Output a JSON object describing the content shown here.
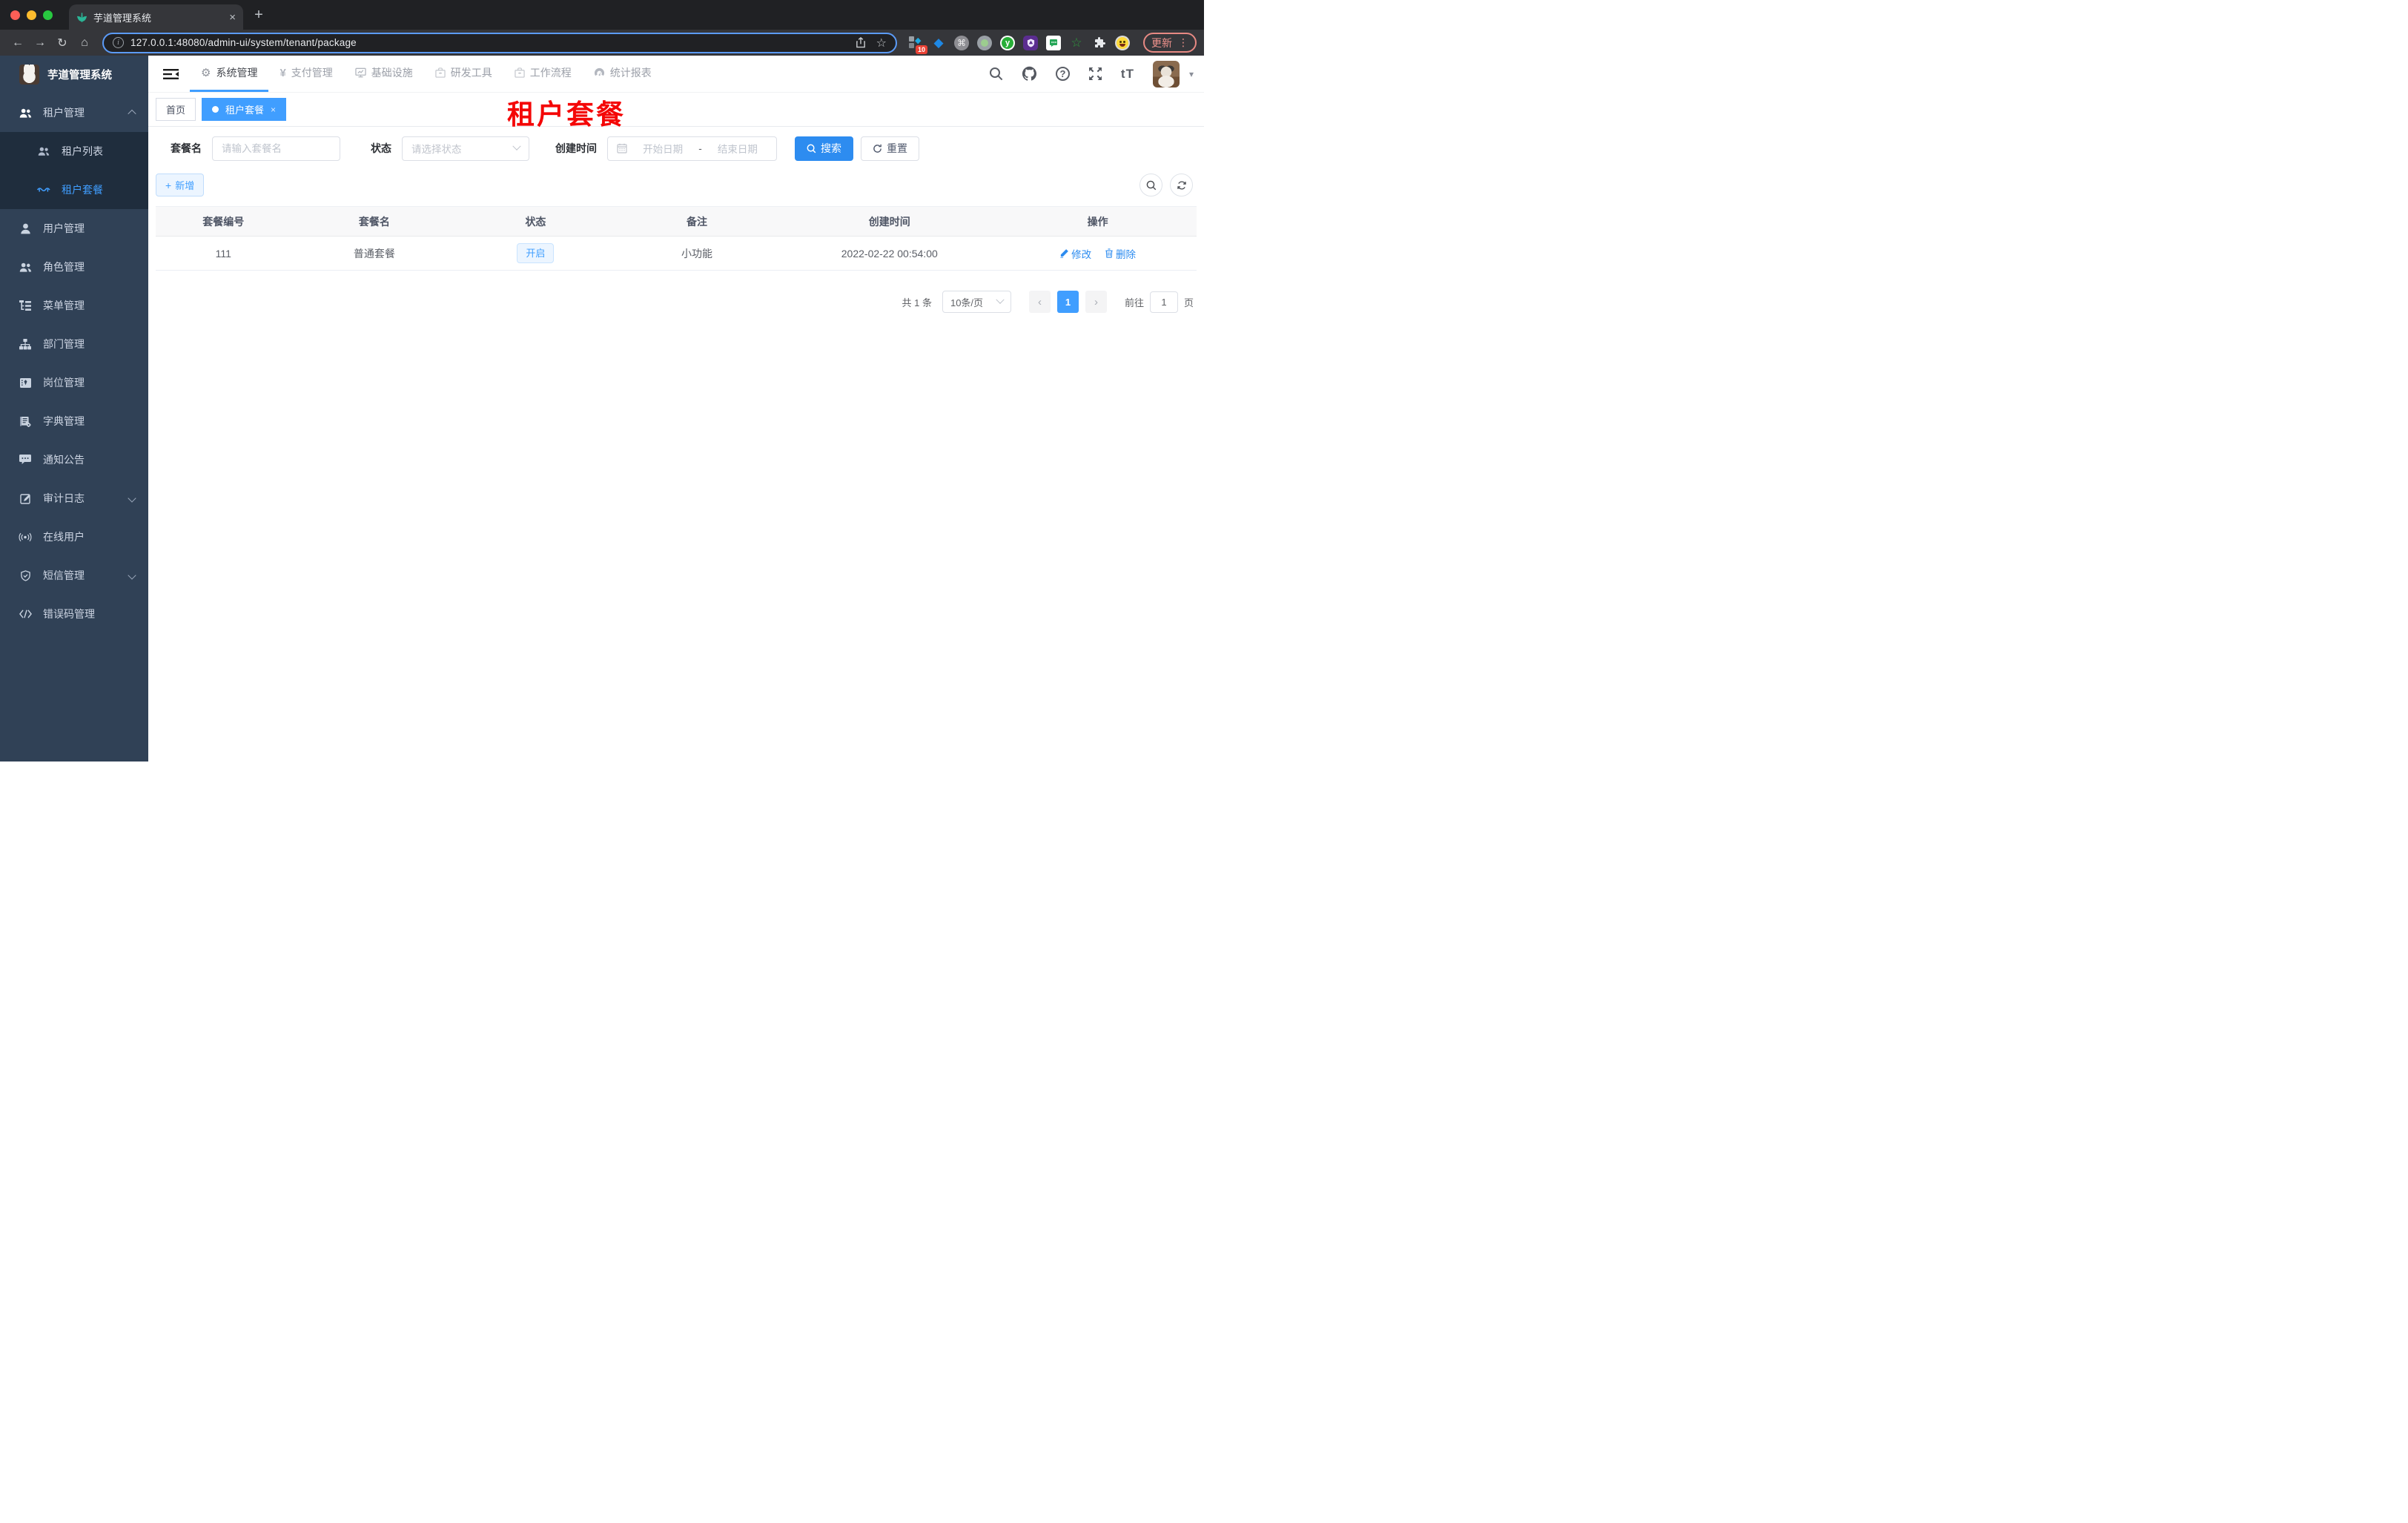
{
  "browser": {
    "tab": {
      "title": "芋道管理系统",
      "close": "×",
      "new_tab": "+"
    },
    "nav": {
      "back": "←",
      "forward": "→",
      "reload": "↻",
      "home": "⌂"
    },
    "url": "127.0.0.1:48080/admin-ui/system/tenant/package",
    "info_glyph": "i",
    "star_glyph": "☆",
    "ext": {
      "badge": "10",
      "diamond": "◆",
      "cmd": "⌘",
      "y": "y",
      "gem": "◆",
      "green_star": "☆"
    },
    "update_label": "更新",
    "menu_dots": "⋮"
  },
  "header": {
    "nav": [
      {
        "label": "系统管理"
      },
      {
        "label": "支付管理"
      },
      {
        "label": "基础设施"
      },
      {
        "label": "研发工具"
      },
      {
        "label": "工作流程"
      },
      {
        "label": "统计报表"
      }
    ],
    "gear_glyph": "⚙",
    "yen_glyph": "¥",
    "help_glyph": "?",
    "text_size_glyph": "tT",
    "caret_glyph": "▾"
  },
  "sidebar": {
    "logo_title": "芋道管理系统",
    "items": [
      {
        "label": "租户管理"
      },
      {
        "label": "租户列表"
      },
      {
        "label": "租户套餐"
      },
      {
        "label": "用户管理"
      },
      {
        "label": "角色管理"
      },
      {
        "label": "菜单管理"
      },
      {
        "label": "部门管理"
      },
      {
        "label": "岗位管理"
      },
      {
        "label": "字典管理"
      },
      {
        "label": "通知公告"
      },
      {
        "label": "审计日志"
      },
      {
        "label": "在线用户"
      },
      {
        "label": "短信管理"
      },
      {
        "label": "错误码管理"
      }
    ]
  },
  "tabs": {
    "home": "首页",
    "active": "租户套餐",
    "close": "×"
  },
  "overlay_title": "租户套餐",
  "filters": {
    "name_label": "套餐名",
    "name_placeholder": "请输入套餐名",
    "status_label": "状态",
    "status_placeholder": "请选择状态",
    "date_label": "创建时间",
    "date_start": "开始日期",
    "date_separator": "-",
    "date_end": "结束日期",
    "search_label": "搜索",
    "reset_label": "重置"
  },
  "toolbar": {
    "add_label": "新增",
    "plus": "+"
  },
  "table": {
    "columns": [
      "套餐编号",
      "套餐名",
      "状态",
      "备注",
      "创建时间",
      "操作"
    ],
    "rows": [
      {
        "id": "111",
        "name": "普通套餐",
        "status": "开启",
        "remark": "小功能",
        "created_at": "2022-02-22 00:54:00"
      }
    ],
    "edit_label": "修改",
    "delete_label": "删除"
  },
  "pagination": {
    "total": "共 1 条",
    "page_size": "10条/页",
    "prev": "‹",
    "page": "1",
    "next": "›",
    "goto_prefix": "前往",
    "goto_value": "1",
    "goto_suffix": "页"
  },
  "colors": {
    "accent": "#409eff",
    "sidebar": "#304156",
    "submenu": "#1f2d3d",
    "overlay": "#f40606"
  }
}
